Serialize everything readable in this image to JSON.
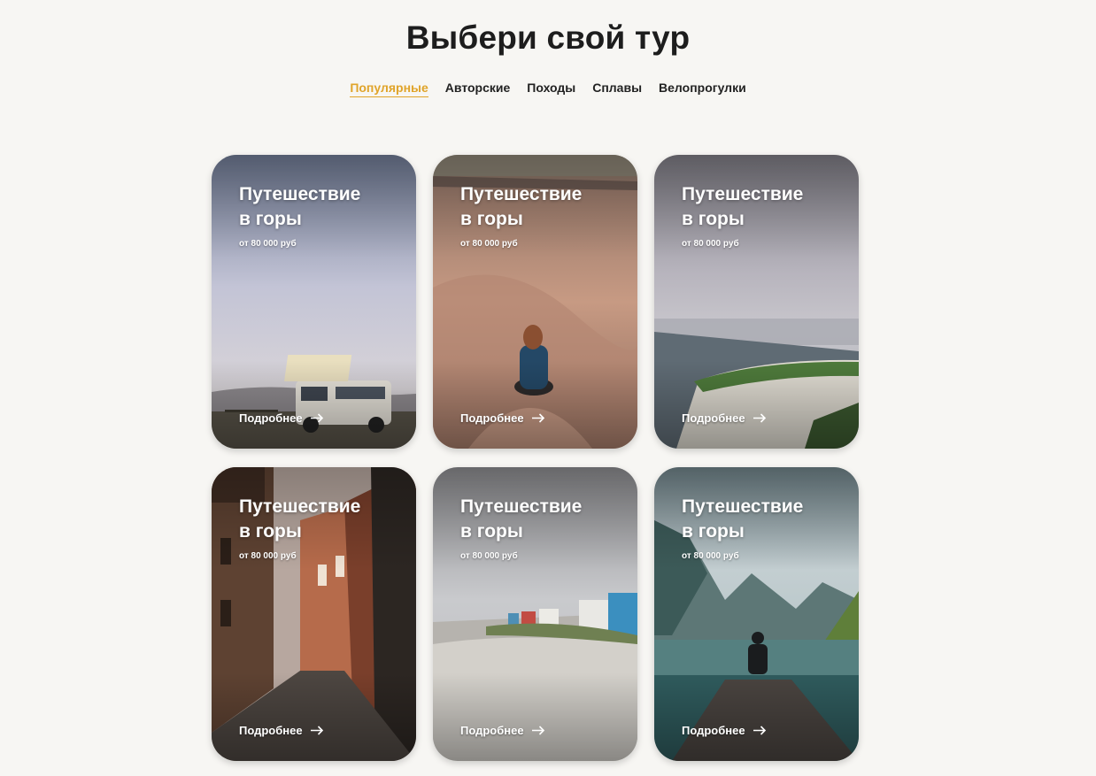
{
  "header": {
    "title": "Выбери свой тур"
  },
  "tabs": [
    {
      "label": "Популярные",
      "active": true
    },
    {
      "label": "Авторские",
      "active": false
    },
    {
      "label": "Походы",
      "active": false
    },
    {
      "label": "Сплавы",
      "active": false
    },
    {
      "label": "Велопрогулки",
      "active": false
    }
  ],
  "colors": {
    "accent": "#e0a42a",
    "background": "#f7f6f3"
  },
  "cards": [
    {
      "title": "Путешествие\nв горы",
      "price": "от 80 000 руб",
      "more_label": "Подробнее",
      "photo": "camper-van-mountains"
    },
    {
      "title": "Путешествие\nв горы",
      "price": "от 80 000 руб",
      "more_label": "Подробнее",
      "photo": "woman-sitting-in-desert-dunes"
    },
    {
      "title": "Путешествие\nв горы",
      "price": "от 80 000 руб",
      "more_label": "Подробнее",
      "photo": "coastal-cliff-with-harbor"
    },
    {
      "title": "Путешествие\nв горы",
      "price": "от 80 000 руб",
      "more_label": "Подробнее",
      "photo": "old-town-cobblestone-street"
    },
    {
      "title": "Путешествие\nв горы",
      "price": "от 80 000 руб",
      "more_label": "Подробнее",
      "photo": "beach-huts-on-shore"
    },
    {
      "title": "Путешествие\nв горы",
      "price": "от 80 000 руб",
      "more_label": "Подробнее",
      "photo": "person-on-pier-at-mountain-lake"
    }
  ]
}
